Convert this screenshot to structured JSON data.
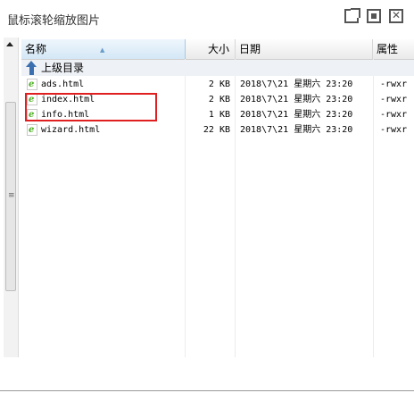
{
  "window": {
    "title": "鼠标滚轮缩放图片",
    "buttons": [
      {
        "name": "popout",
        "icon": "popout-icon"
      },
      {
        "name": "maximize",
        "icon": "maximize-icon"
      },
      {
        "name": "close",
        "icon": "close-icon"
      }
    ]
  },
  "table": {
    "columns": {
      "name": "名称",
      "size": "大小",
      "date": "日期",
      "attr": "属性"
    },
    "updir": {
      "label": "上级目录",
      "icon": "up-arrow-icon"
    },
    "files": [
      {
        "name": "ads.html",
        "size": "2 KB",
        "date": "2018\\7\\21 星期六 23:20",
        "attr": "-rwxr",
        "icon": "html-file-icon"
      },
      {
        "name": "index.html",
        "size": "2 KB",
        "date": "2018\\7\\21 星期六 23:20",
        "attr": "-rwxr",
        "icon": "html-file-icon"
      },
      {
        "name": "info.html",
        "size": "1 KB",
        "date": "2018\\7\\21 星期六 23:20",
        "attr": "-rwxr",
        "icon": "html-file-icon"
      },
      {
        "name": "wizard.html",
        "size": "22 KB",
        "date": "2018\\7\\21 星期六 23:20",
        "attr": "-rwxr",
        "icon": "html-file-icon"
      }
    ]
  },
  "colors": {
    "highlight": "#e02020",
    "html_icon": "#4caf22",
    "updir_icon": "#3b6fb0"
  }
}
